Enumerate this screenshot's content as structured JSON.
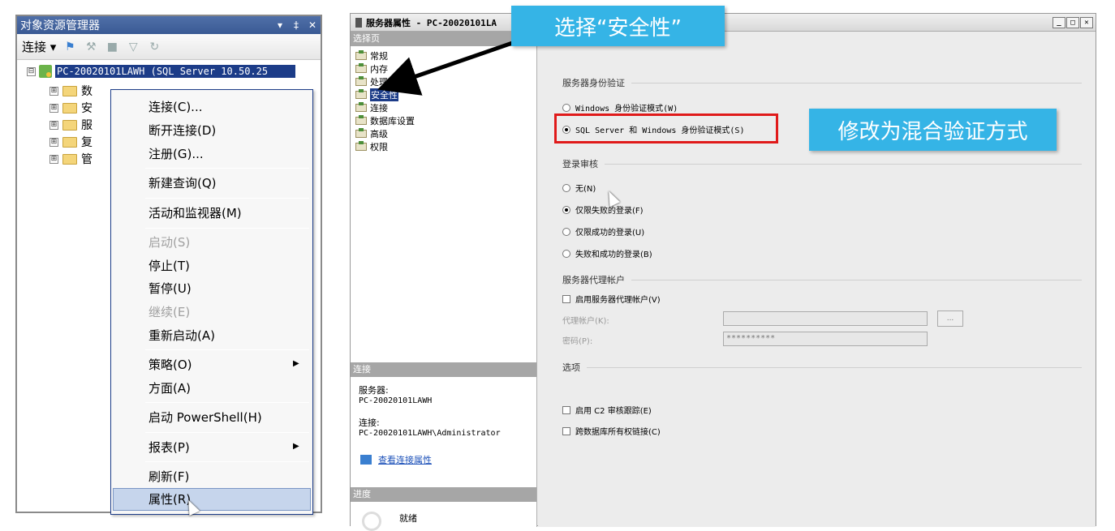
{
  "object_explorer": {
    "title": "对象资源管理器",
    "title_buttons": [
      "▾",
      "‡",
      "✕"
    ],
    "toolbar": {
      "connect_label": "连接 ▾"
    },
    "tree": {
      "server_label": "PC-20020101LAWH (SQL Server 10.50.25",
      "root_expander": "⊟",
      "child_expander": "⊞",
      "children": [
        "数",
        "安",
        "服",
        "复",
        "管"
      ]
    },
    "context_menu": {
      "items": [
        {
          "label": "连接(C)..."
        },
        {
          "label": "断开连接(D)"
        },
        {
          "label": "注册(G)..."
        },
        {
          "label": "新建查询(Q)"
        },
        {
          "label": "活动和监视器(M)"
        },
        {
          "label": "启动(S)",
          "disabled": true
        },
        {
          "label": "停止(T)"
        },
        {
          "label": "暂停(U)"
        },
        {
          "label": "继续(E)",
          "disabled": true
        },
        {
          "label": "重新启动(A)"
        },
        {
          "label": "策略(O)",
          "submenu": true
        },
        {
          "label": "方面(A)"
        },
        {
          "label": "启动 PowerShell(H)"
        },
        {
          "label": "报表(P)",
          "submenu": true
        },
        {
          "label": "刷新(F)"
        },
        {
          "label": "属性(R)",
          "highlighted": true
        }
      ]
    }
  },
  "server_properties": {
    "title": "服务器属性 - PC-20020101LA",
    "window_buttons": [
      "_",
      "□",
      "✕"
    ],
    "select_page_header": "选择页",
    "pages": [
      "常规",
      "内存",
      "处理器",
      "安全性",
      "连接",
      "数据库设置",
      "高级",
      "权限"
    ],
    "selected_page": "安全性",
    "connection_header": "连接",
    "server_label": "服务器:",
    "server_value": "PC-20020101LAWH",
    "connection_label": "连接:",
    "connection_value": "PC-20020101LAWH\\Administrator",
    "view_conn_link": "查看连接属性",
    "progress_header": "进度",
    "progress_status": "就绪",
    "sections": {
      "auth": "服务器身份验证",
      "audit": "登录审核",
      "proxy": "服务器代理帐户",
      "options": "选项"
    },
    "auth_options": [
      {
        "label": "Windows 身份验证模式(W)",
        "checked": false
      },
      {
        "label": "SQL Server 和 Windows 身份验证模式(S)",
        "checked": true
      }
    ],
    "audit_options": [
      {
        "label": "无(N)",
        "checked": false
      },
      {
        "label": "仅限失败的登录(F)",
        "checked": true
      },
      {
        "label": "仅限成功的登录(U)",
        "checked": false
      },
      {
        "label": "失败和成功的登录(B)",
        "checked": false
      }
    ],
    "proxy_enable": "启用服务器代理帐户(V)",
    "proxy_account_label": "代理帐户(K):",
    "password_label": "密码(P):",
    "password_value": "**********",
    "browse_label": "...",
    "option_c2": "启用 C2 审核跟踪(E)",
    "option_cross_db": "跨数据库所有权链接(C)"
  },
  "annotations": {
    "callout_security": "选择“安全性”",
    "callout_mixed": "修改为混合验证方式",
    "callout_color": "#35b4e6",
    "highlight_color": "#e01a1a"
  }
}
